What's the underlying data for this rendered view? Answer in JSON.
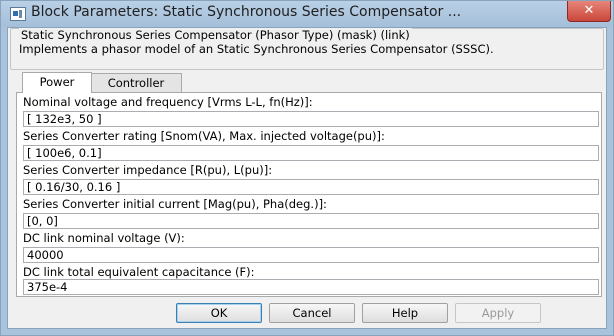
{
  "window": {
    "title": "Block Parameters: Static Synchronous Series Compensator ...",
    "close_label": "✕"
  },
  "mask": {
    "group_title": "Static Synchronous Series Compensator (Phasor Type) (mask) (link)",
    "description": "Implements a phasor model of an Static Synchronous Series Compensator (SSSC)."
  },
  "tabs": [
    {
      "label": "Power",
      "active": true
    },
    {
      "label": "Controller",
      "active": false
    }
  ],
  "params": [
    {
      "label": "Nominal voltage and frequency [Vrms L-L, fn(Hz)]:",
      "value": "[ 132e3, 50 ]"
    },
    {
      "label": "Series Converter rating [Snom(VA), Max. injected voltage(pu)]:",
      "value": "[ 100e6, 0.1]"
    },
    {
      "label": "Series Converter impedance [R(pu), L(pu)]:",
      "value": "[ 0.16/30, 0.16 ]"
    },
    {
      "label": "Series Converter initial current [Mag(pu), Pha(deg.)]:",
      "value": "[0, 0]"
    },
    {
      "label": "DC link nominal voltage (V):",
      "value": "40000"
    },
    {
      "label": "DC link total equivalent capacitance (F):",
      "value": "375e-4"
    }
  ],
  "buttons": {
    "ok": "OK",
    "cancel": "Cancel",
    "help": "Help",
    "apply": "Apply"
  },
  "icons": {
    "title": "block-parameters-icon",
    "close": "close-icon"
  },
  "colors": {
    "titlebar": "#a9c3dc",
    "close_button": "#c9463a",
    "ok_border": "#3c7fb1"
  }
}
